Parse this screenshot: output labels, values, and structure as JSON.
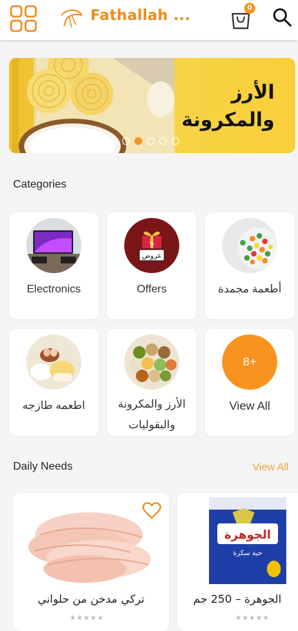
{
  "header": {
    "title": "Fathallah ...",
    "cart_count": "0",
    "icons": [
      "grid-menu-icon",
      "fathallah-logo-icon",
      "shopping-bag-icon",
      "search-icon"
    ]
  },
  "banner": {
    "title_line1": "الأرز",
    "title_line2": "والمكرونة",
    "slide_count": 6,
    "active_slide": 3
  },
  "categories": {
    "title": "Categories",
    "items": [
      {
        "label": "Electronics",
        "image": "tv-electronics"
      },
      {
        "label": "Offers",
        "image": "offers-gift-box",
        "image_text_top": "%",
        "image_text": "عروض"
      },
      {
        "label": "أطعمة مجمدة",
        "image": "frozen-vegetables"
      },
      {
        "label": "اطعمه طازجه",
        "image": "fresh-food"
      },
      {
        "label_line1": "الأرز والمكرونة",
        "label_line2": "والبقوليات",
        "image": "rice-pasta-legumes"
      },
      {
        "label": "View All",
        "badge": "8+"
      }
    ]
  },
  "daily_needs": {
    "title": "Daily Needs",
    "view_all": "View All",
    "products": [
      {
        "name": "تركي مدخن من حلواني",
        "image": "smoked-turkey-slices",
        "stars": "★★★★★"
      },
      {
        "name": "الجوهرة – 250 جم",
        "image": "al-gawhara-tea-pack",
        "stars": "★★★★★",
        "pack_brand": "الجوهرة",
        "pack_text": "حبة سكرة"
      }
    ]
  },
  "colors": {
    "accent": "#f7931e",
    "title_orange": "#f08a1c",
    "banner_yellow": "#f7d64a",
    "view_all_link": "#f0a23a"
  }
}
